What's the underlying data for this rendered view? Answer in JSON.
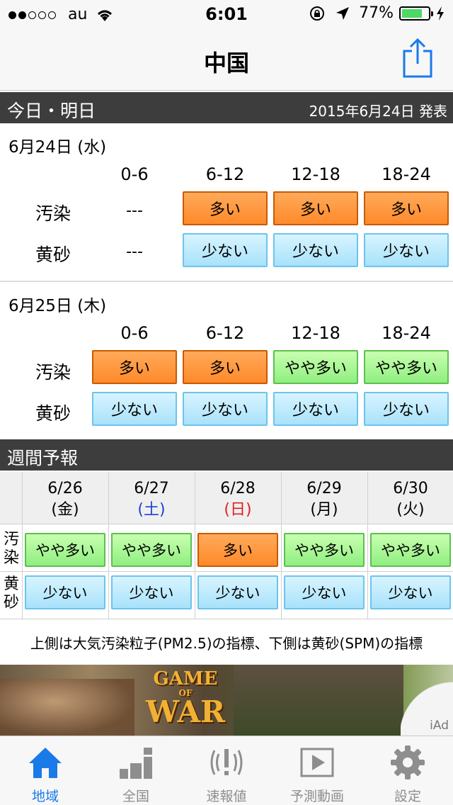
{
  "status_bar": {
    "carrier": "au",
    "time": "6:01",
    "battery": "77%",
    "battery_level": 0.77
  },
  "nav": {
    "title": "中国"
  },
  "today_section": {
    "title": "今日・明日",
    "issued": "2015年6月24日 発表"
  },
  "time_slots": [
    "0-6",
    "6-12",
    "12-18",
    "18-24"
  ],
  "row_labels": {
    "pollution": "汚染",
    "dust": "黄砂"
  },
  "days": [
    {
      "date": "6月24日 (水)",
      "pollution": [
        "---",
        "多い",
        "多い",
        "多い"
      ],
      "dust": [
        "---",
        "少ない",
        "少ない",
        "少ない"
      ]
    },
    {
      "date": "6月25日 (木)",
      "pollution": [
        "多い",
        "多い",
        "やや多い",
        "やや多い"
      ],
      "dust": [
        "少ない",
        "少ない",
        "少ない",
        "少ない"
      ]
    }
  ],
  "weekly": {
    "title": "週間予報",
    "side_labels": {
      "pollution": [
        "汚",
        "染"
      ],
      "dust": [
        "黄",
        "砂"
      ]
    },
    "days": [
      {
        "date": "6/26",
        "weekday": "(金)",
        "pollution": "やや多い",
        "dust": "少ない"
      },
      {
        "date": "6/27",
        "weekday": "(土)",
        "pollution": "やや多い",
        "dust": "少ない"
      },
      {
        "date": "6/28",
        "weekday": "(日)",
        "pollution": "多い",
        "dust": "少ない"
      },
      {
        "date": "6/29",
        "weekday": "(月)",
        "pollution": "やや多い",
        "dust": "少ない"
      },
      {
        "date": "6/30",
        "weekday": "(火)",
        "pollution": "やや多い",
        "dust": "少ない"
      }
    ]
  },
  "note": "上側は大気汚染粒子(PM2.5)の指標、下側は黄砂(SPM)の指標",
  "ad": {
    "logo_top": "GAME",
    "logo_mid": "OF",
    "logo_bottom": "WAR",
    "label": "iAd"
  },
  "tabs": [
    {
      "label": "地域",
      "icon": "home-icon",
      "active": true
    },
    {
      "label": "全国",
      "icon": "bar-chart-icon",
      "active": false
    },
    {
      "label": "速報値",
      "icon": "alert-signal-icon",
      "active": false
    },
    {
      "label": "予測動画",
      "icon": "play-video-icon",
      "active": false
    },
    {
      "label": "設定",
      "icon": "gear-icon",
      "active": false
    }
  ],
  "colors": {
    "high": "#ff9a3c",
    "moderate": "#a8f294",
    "low": "#b8e8fc",
    "accent": "#1a7ae8",
    "saturday": "#2040d8",
    "sunday": "#e02020"
  }
}
